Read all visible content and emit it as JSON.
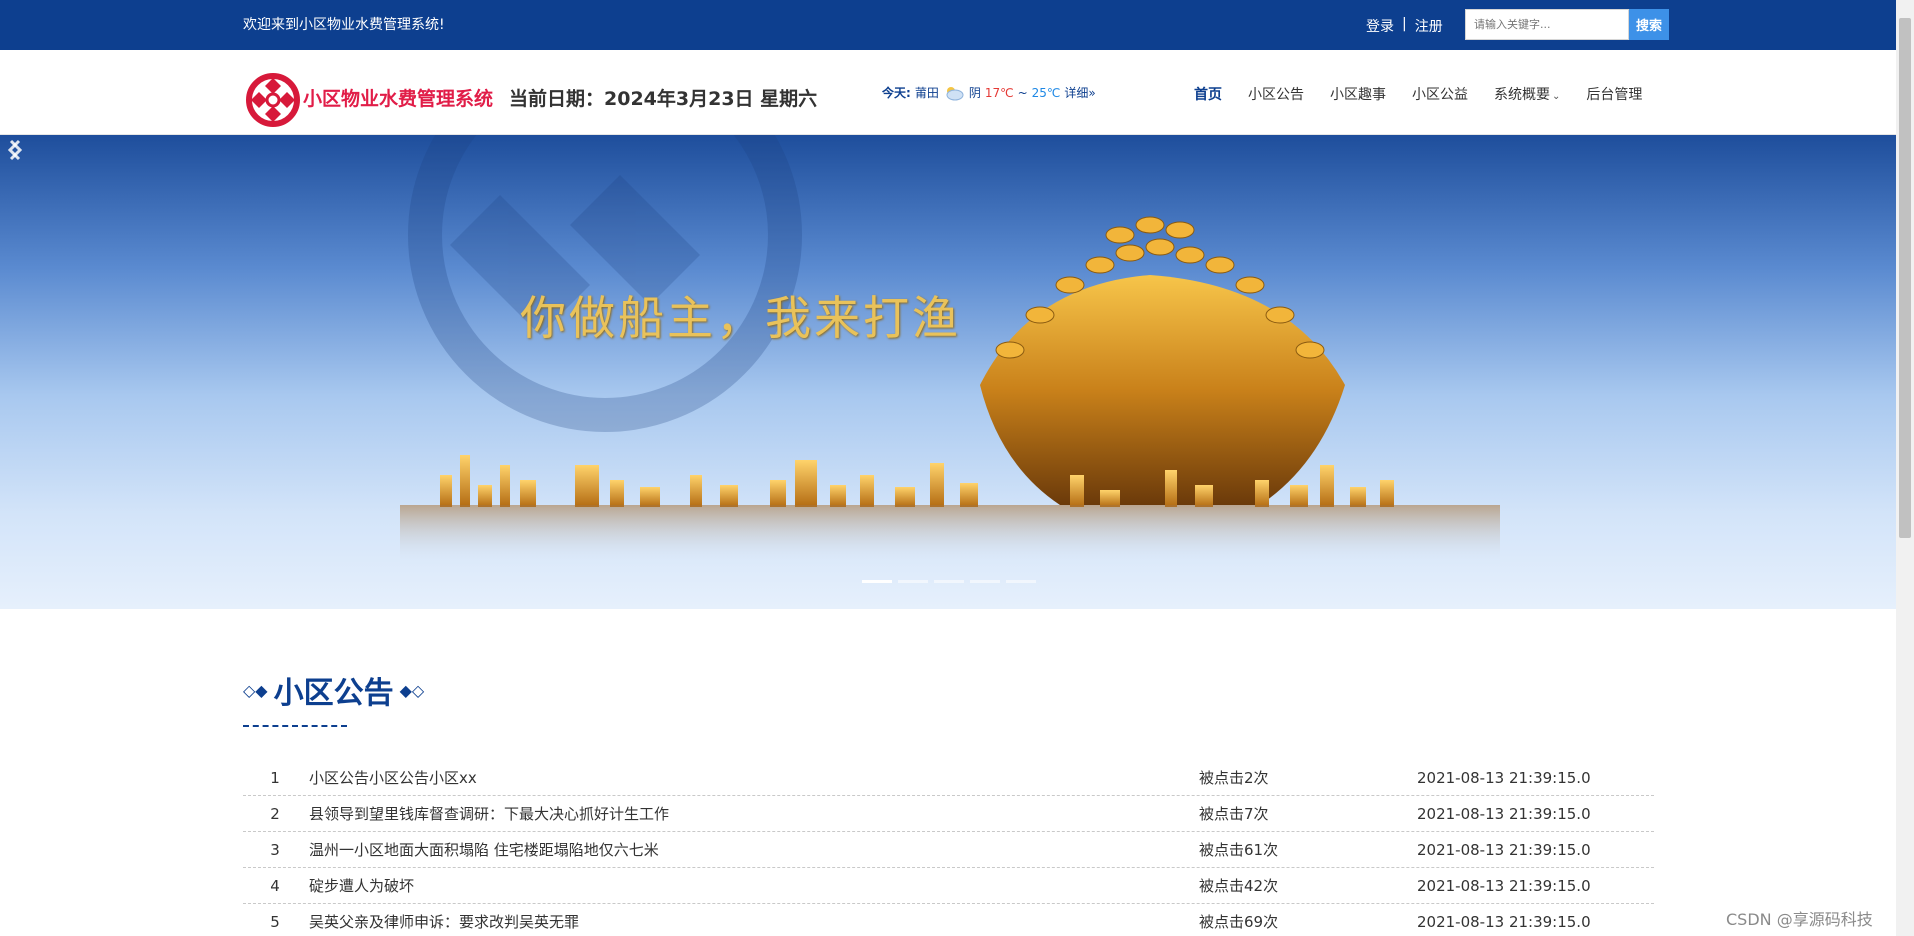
{
  "topbar": {
    "welcome": "欢迎来到小区物业水费管理系统!",
    "login": "登录",
    "separator": "|",
    "register": "注册",
    "search_placeholder": "请输入关键字...",
    "search_button": "搜索"
  },
  "header": {
    "site_title": "小区物业水费管理系统",
    "current_date": "当前日期：2024年3月23日 星期六",
    "weather": {
      "label": "今天:",
      "city": "莆田",
      "condition": "阴",
      "high": "17℃",
      "tilde": "~",
      "low": "25℃",
      "detail": "详细»"
    },
    "nav": [
      {
        "label": "首页",
        "active": true
      },
      {
        "label": "小区公告",
        "active": false
      },
      {
        "label": "小区趣事",
        "active": false
      },
      {
        "label": "小区公益",
        "active": false
      },
      {
        "label": "系统概要",
        "active": false,
        "dropdown": true
      },
      {
        "label": "后台管理",
        "active": false
      }
    ]
  },
  "banner": {
    "slogan": "你做船主，我来打渔",
    "slide_count": 5,
    "active_slide": 1
  },
  "notices": {
    "title": "小区公告",
    "rows": [
      {
        "index": "1",
        "title": "小区公告小区公告小区xx",
        "clicks": "被点击2次",
        "time": "2021-08-13 21:39:15.0"
      },
      {
        "index": "2",
        "title": "县领导到望里钱库督查调研：下最大决心抓好计生工作",
        "clicks": "被点击7次",
        "time": "2021-08-13 21:39:15.0"
      },
      {
        "index": "3",
        "title": "温州一小区地面大面积塌陷 住宅楼距塌陷地仅六七米",
        "clicks": "被点击61次",
        "time": "2021-08-13 21:39:15.0"
      },
      {
        "index": "4",
        "title": "碇步遭人为破坏",
        "clicks": "被点击42次",
        "time": "2021-08-13 21:39:15.0"
      },
      {
        "index": "5",
        "title": "吴英父亲及律师申诉：要求改判吴英无罪",
        "clicks": "被点击69次",
        "time": "2021-08-13 21:39:15.0"
      }
    ]
  },
  "watermark": "CSDN @享源码科技",
  "colors": {
    "primary": "#0d3f8f",
    "accent_red": "#e11d48",
    "search_button": "#3d91e8"
  }
}
